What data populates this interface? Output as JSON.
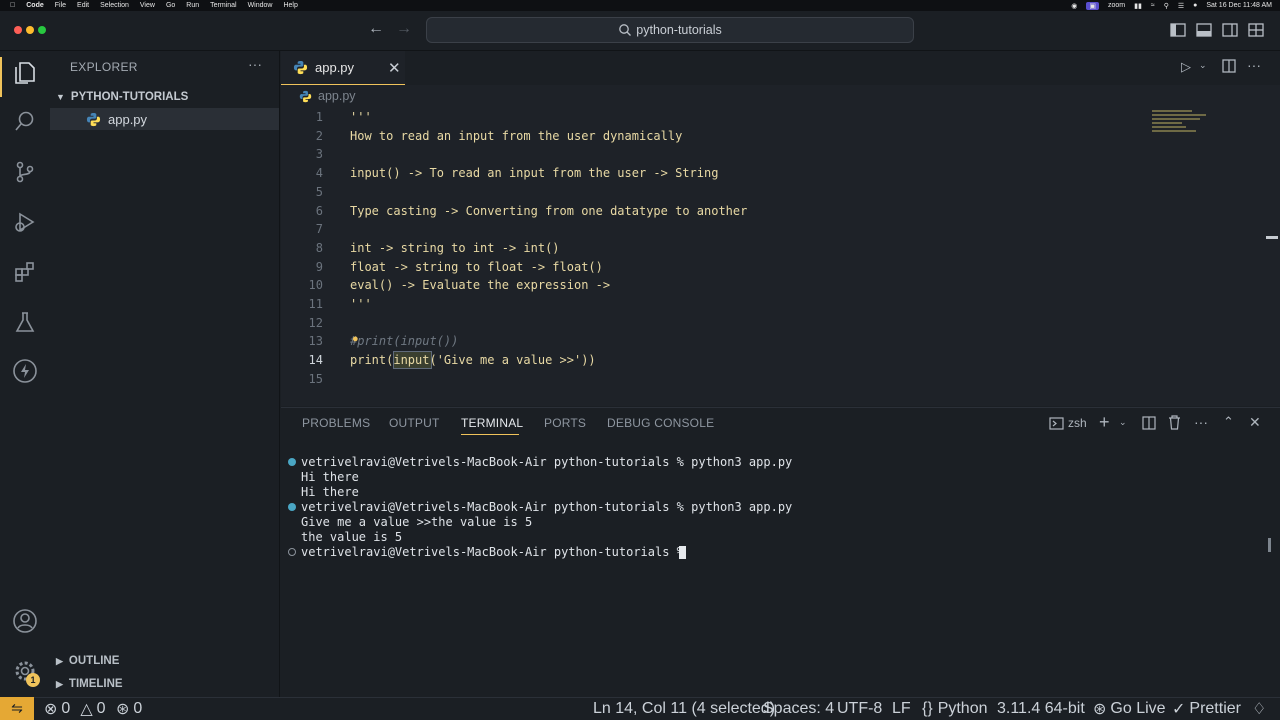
{
  "menubar": {
    "items": [
      "Code",
      "File",
      "Edit",
      "Selection",
      "View",
      "Go",
      "Run",
      "Terminal",
      "Window",
      "Help"
    ],
    "zoom": "zoom",
    "datetime": "Sat 16 Dec  11:48 AM"
  },
  "titlebar": {
    "search": "python-tutorials"
  },
  "sidebar": {
    "title": "EXPLORER",
    "folder": "PYTHON-TUTORIALS",
    "file": "app.py",
    "outline": "OUTLINE",
    "timeline": "TIMELINE"
  },
  "activity": {
    "settings_badge": "1"
  },
  "editor": {
    "tab_label": "app.py",
    "breadcrumb": "app.py",
    "lines": [
      {
        "n": "1",
        "t": "'''"
      },
      {
        "n": "2",
        "t": "How to read an input from the user dynamically"
      },
      {
        "n": "3",
        "t": ""
      },
      {
        "n": "4",
        "t": "input() -> To read an input from the user -> String"
      },
      {
        "n": "5",
        "t": ""
      },
      {
        "n": "6",
        "t": "Type casting -> Converting from one datatype to another"
      },
      {
        "n": "7",
        "t": ""
      },
      {
        "n": "8",
        "t": "int -> string to int -> int()"
      },
      {
        "n": "9",
        "t": "float -> string to float -> float()"
      },
      {
        "n": "10",
        "t": "eval() -> Evaluate the expression ->"
      },
      {
        "n": "11",
        "t": "'''"
      },
      {
        "n": "12",
        "t": ""
      },
      {
        "n": "13",
        "t": "#print(input())"
      },
      {
        "n": "14",
        "t": "print(input('Give me a value >>'))"
      },
      {
        "n": "15",
        "t": ""
      }
    ]
  },
  "panel": {
    "tabs": [
      "PROBLEMS",
      "OUTPUT",
      "TERMINAL",
      "PORTS",
      "DEBUG CONSOLE"
    ],
    "active_tab": "TERMINAL",
    "shell": "zsh",
    "terminal_lines": [
      "vetrivelravi@Vetrivels-MacBook-Air python-tutorials % python3 app.py",
      "Hi there",
      "Hi there",
      "vetrivelravi@Vetrivels-MacBook-Air python-tutorials % python3 app.py",
      "Give me a value >>the value is 5",
      "the value is 5",
      "vetrivelravi@Vetrivels-MacBook-Air python-tutorials % "
    ]
  },
  "status": {
    "errors": "0",
    "warnings": "0",
    "ports": "0",
    "position": "Ln 14, Col 11 (4 selected)",
    "spaces": "Spaces: 4",
    "encoding": "UTF-8",
    "eol": "LF",
    "language": "Python",
    "interpreter": "3.11.4 64-bit",
    "golive": "Go Live",
    "prettier": "Prettier"
  },
  "colors": {
    "accent": "#f0c35b",
    "remote": "#e5a834",
    "code_text": "#e8d9a4"
  }
}
